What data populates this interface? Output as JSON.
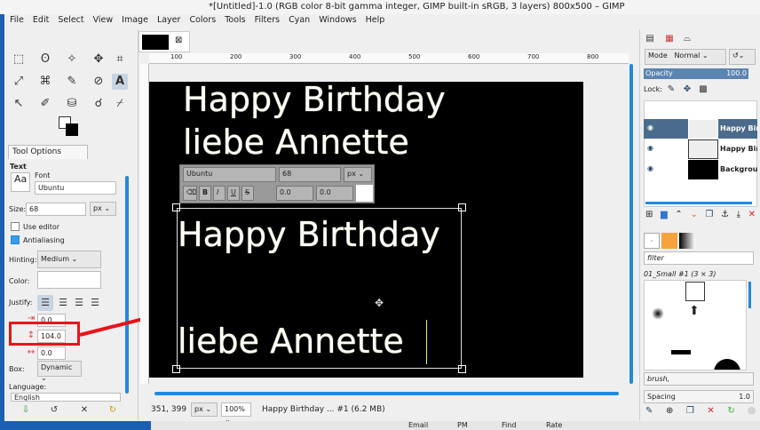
{
  "window": {
    "title": "*[Untitled]-1.0 (RGB color 8-bit gamma integer, GIMP built-in sRGB, 3 layers) 800x500 – GIMP"
  },
  "menu": [
    "File",
    "Edit",
    "Select",
    "View",
    "Image",
    "Layer",
    "Colors",
    "Tools",
    "Filters",
    "Cyan",
    "Windows",
    "Help"
  ],
  "tool_options": {
    "tab": "Tool Options",
    "section": "Text",
    "font_label": "Font",
    "font": "Ubuntu",
    "size_label": "Size:",
    "size": "68",
    "unit": "px",
    "use_editor": "Use editor",
    "antialiasing": "Antialiasing",
    "hinting_label": "Hinting:",
    "hinting": "Medium",
    "color_label": "Color:",
    "justify_label": "Justify:",
    "indent": "0.0",
    "line_spacing": "104.0",
    "letter_spacing": "0.0",
    "box_label": "Box:",
    "box": "Dynamic",
    "language_label": "Language:",
    "language": "English"
  },
  "ruler": [
    "100",
    "200",
    "300",
    "400",
    "500",
    "600",
    "700",
    "800"
  ],
  "canvas": {
    "line1": "Happy Birthday",
    "line2": "liebe Annette",
    "edit_line1": "Happy Birthday",
    "edit_line2": "liebe Annette"
  },
  "text_toolbar": {
    "font": "Ubuntu",
    "size": "68",
    "unit": "px",
    "baseline": "0.0",
    "kerning": "0.0",
    "bold": "B",
    "italic": "I",
    "underline": "U",
    "strike": "S"
  },
  "status": {
    "coords": "351, 399",
    "unit": "px",
    "zoom": "100%",
    "info": "Happy Birthday ... #1 (6.2 MB)"
  },
  "layers": {
    "mode_label": "Mode",
    "mode": "Normal",
    "opacity_label": "Opacity",
    "opacity": "100.0",
    "lock_label": "Lock:",
    "items": [
      {
        "name": "Happy Birthday",
        "selected": true
      },
      {
        "name": "Happy Birthday",
        "selected": false
      },
      {
        "name": "Background",
        "selected": false
      }
    ]
  },
  "brushes": {
    "filter": "filter",
    "brush_name": "01_Small #1 (3 × 3)",
    "tag": "brush,",
    "spacing_label": "Spacing",
    "spacing": "1.0"
  },
  "taskbar": [
    "Email",
    "PM",
    "Find",
    "Rate"
  ],
  "colors": {
    "accent": "#1e8ae0",
    "highlight": "#e8141a",
    "selected_layer": "#4b6b8c"
  }
}
